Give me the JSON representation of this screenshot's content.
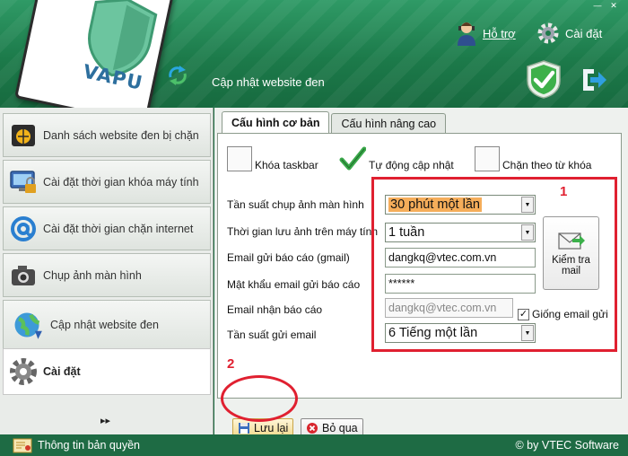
{
  "header": {
    "logo_text": "VAPU",
    "title": "Cập nhật website đen",
    "help_label": "Hỗ trợ",
    "settings_label": "Cài đặt",
    "window_controls": [
      "—",
      "✕"
    ]
  },
  "sidebar": {
    "items": [
      {
        "label": "Danh sách website đen bị chặn",
        "icon": "blocked-websites-icon"
      },
      {
        "label": "Cài đặt thời gian khóa máy tính",
        "icon": "computer-lock-icon"
      },
      {
        "label": "Cài đặt thời gian chặn internet",
        "icon": "at-sign-icon"
      },
      {
        "label": "Chụp ảnh màn hình",
        "icon": "camera-icon"
      },
      {
        "label": "Cập nhật website đen",
        "icon": "globe-update-icon"
      },
      {
        "label": "Cài đặt",
        "icon": "gear-icon",
        "active": true
      }
    ],
    "more": "▸▸"
  },
  "main": {
    "tabs": [
      {
        "label": "Cấu hình cơ bản",
        "active": true
      },
      {
        "label": "Cấu hình nâng cao",
        "active": false
      }
    ],
    "checkboxes": [
      {
        "label": "Khóa taskbar",
        "checked": false
      },
      {
        "label": "Tự động cập nhật",
        "checked": true
      },
      {
        "label": "Chặn theo từ khóa",
        "checked": false
      }
    ],
    "fields": {
      "screenshot_freq_label": "Tần suất chụp ảnh màn hình",
      "screenshot_freq_value": "30 phút một lần",
      "retention_label": "Thời gian lưu ảnh trên máy tính",
      "retention_value": "1 tuần",
      "report_email_label": "Email gửi báo cáo (gmail)",
      "report_email_value": "dangkq@vtec.com.vn",
      "password_label": "Mật khẩu email gửi báo cáo",
      "password_value": "******",
      "receive_email_label": "Email nhận báo cáo",
      "receive_email_value": "dangkq@vtec.com.vn",
      "same_email_label": "Giống email gửi",
      "send_freq_label": "Tần suất gửi email",
      "send_freq_value": "6 Tiếng một lần"
    },
    "test_mail_label": "Kiểm tra mail",
    "save_label": "Lưu lại",
    "cancel_label": "Bỏ qua"
  },
  "annotations": {
    "box_number": "1",
    "save_number": "2",
    "color": "#e02030"
  },
  "footer": {
    "license_label": "Thông tin bản quyền",
    "copyright": "© by VTEC Software"
  }
}
